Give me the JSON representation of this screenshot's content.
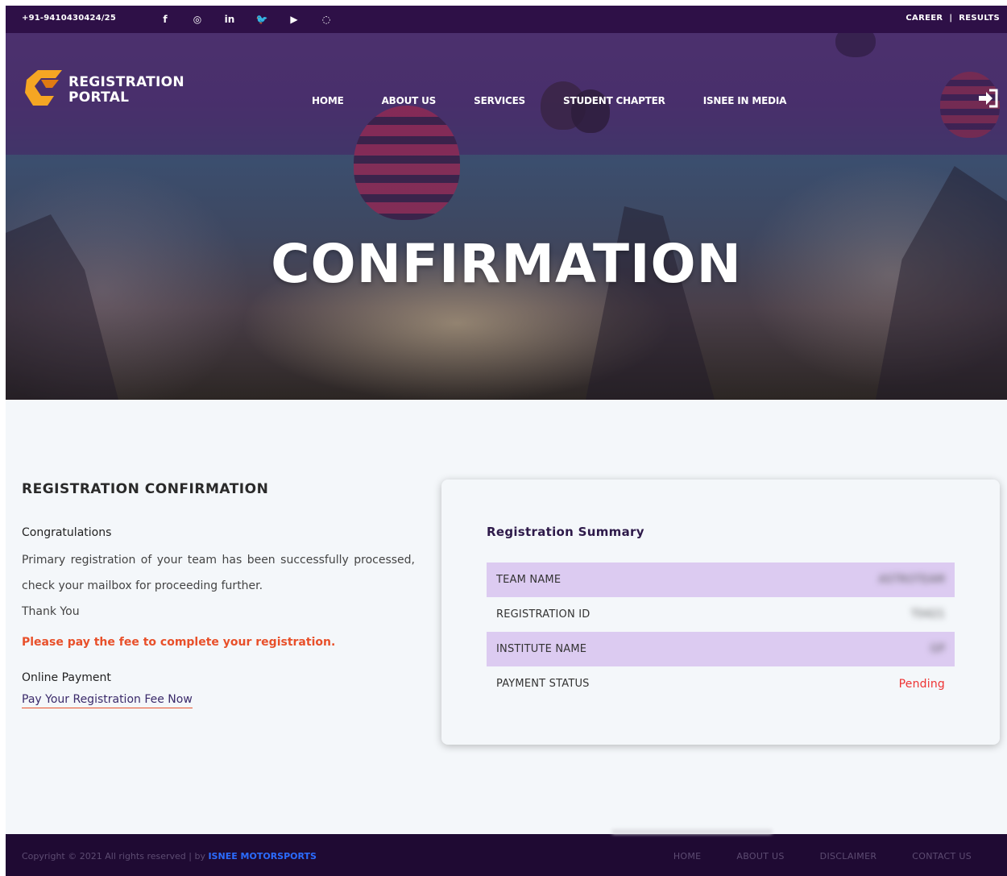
{
  "topbar": {
    "phone": "+91-9410430424/25",
    "socials": [
      {
        "icon": "facebook-icon",
        "glyph": "f"
      },
      {
        "icon": "instagram-icon",
        "glyph": "◎"
      },
      {
        "icon": "linkedin-icon",
        "glyph": "in"
      },
      {
        "icon": "twitter-icon",
        "glyph": "🐦"
      },
      {
        "icon": "youtube-icon",
        "glyph": "▶"
      },
      {
        "icon": "whatsapp-icon",
        "glyph": "◌"
      }
    ],
    "links": {
      "career": "CAREER",
      "separator": "|",
      "results": "RESULTS"
    }
  },
  "header": {
    "logo": {
      "line1": "REGISTRATION",
      "line2": "PORTAL"
    },
    "nav": [
      "HOME",
      "ABOUT US",
      "SERVICES",
      "STUDENT CHAPTER",
      "ISNEE IN MEDIA"
    ],
    "login_icon": "sign-in-icon"
  },
  "hero": {
    "title": "CONFIRMATION"
  },
  "confirmation": {
    "heading": "REGISTRATION CONFIRMATION",
    "congrats": "Congratulations",
    "message": "Primary registration of your team has been successfully processed, check your mailbox for proceeding further.",
    "thanks": "Thank You",
    "warning": "Please pay the fee to complete your registration.",
    "payment_label": "Online Payment",
    "payment_link": "Pay Your Registration Fee Now"
  },
  "summary": {
    "title": "Registration Summary",
    "rows": [
      {
        "label": "TEAM NAME",
        "value": "ASTROTEAM"
      },
      {
        "label": "REGISTRATION ID",
        "value": "T0421"
      },
      {
        "label": "INSTITUTE NAME",
        "value": "GP"
      },
      {
        "label": "PAYMENT STATUS",
        "value": "Pending"
      }
    ]
  },
  "footer": {
    "copyright": "Copyright © 2021 All rights reserved | by",
    "brand": "ISNEE MOTORSPORTS",
    "links": [
      "HOME",
      "ABOUT US",
      "DISCLAIMER",
      "CONTACT US"
    ]
  },
  "colors": {
    "topbar": "#2e1047",
    "footer": "#1f0a33",
    "row_shade": "#dccbf1",
    "warning": "#e8502a",
    "pending": "#e33333",
    "brand_link": "#2b6cff"
  }
}
